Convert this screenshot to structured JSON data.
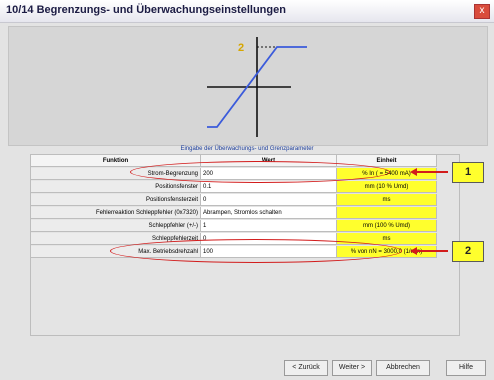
{
  "window": {
    "title": "10/14 Begrenzungs- und Überwachungseinstellungen",
    "close_glyph": "x"
  },
  "graphic": {
    "label": "2"
  },
  "caption": "Eingabe der Überwachungs- und Grenzparameter",
  "table": {
    "headers": [
      "Funktion",
      "Wert",
      "Einheit"
    ],
    "rows": [
      {
        "function": "Strom-Begrenzung",
        "value": "200",
        "unit": "% In ( = 5400 mA)"
      },
      {
        "function": "Positionsfenster",
        "value": "0.1",
        "unit": "mm (10 % Umd)"
      },
      {
        "function": "Positionsfensterzeit",
        "value": "0",
        "unit": "ms"
      },
      {
        "function": "Fehlerreaktion Schleppfehler (0x7320)",
        "value": "Abrampen, Stromlos schalten",
        "unit": ""
      },
      {
        "function": "Schleppfehler (+/-)",
        "value": "1",
        "unit": "mm (100 % Umd)"
      },
      {
        "function": "Schleppfehlerzeit",
        "value": "0",
        "unit": "ms"
      },
      {
        "function": "Max. Betriebsdrehzahl",
        "value": "100",
        "unit": "% von nN = 3000.0 (1/min)"
      }
    ]
  },
  "callouts": {
    "first": "1",
    "second": "2"
  },
  "buttons": {
    "back": "< Zurück",
    "next": "Weiter >",
    "cancel": "Abbrechen",
    "help": "Hilfe"
  },
  "colors": {
    "highlight": "#ffff2d",
    "marker": "#d21c1c",
    "curve": "#3b5bdb"
  }
}
